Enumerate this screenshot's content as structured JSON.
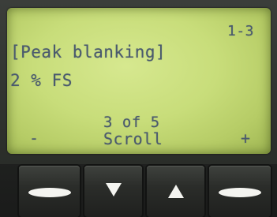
{
  "display": {
    "page_indicator": "1-3",
    "parameter_title": "[Peak blanking]",
    "parameter_value": "2 % FS",
    "item_counter": "3 of 5",
    "mode_label": "Scroll",
    "left_softkey_label": "-",
    "right_softkey_label": "+"
  },
  "keys": [
    {
      "name": "left-softkey",
      "icon": "dash-icon"
    },
    {
      "name": "down-key",
      "icon": "triangle-down-icon"
    },
    {
      "name": "up-key",
      "icon": "triangle-up-icon"
    },
    {
      "name": "right-softkey",
      "icon": "dash-icon"
    }
  ],
  "colors": {
    "lcd_background": "#c8dd7a",
    "lcd_text": "#4a5a6e",
    "key_glyph": "#f4f4f0"
  }
}
